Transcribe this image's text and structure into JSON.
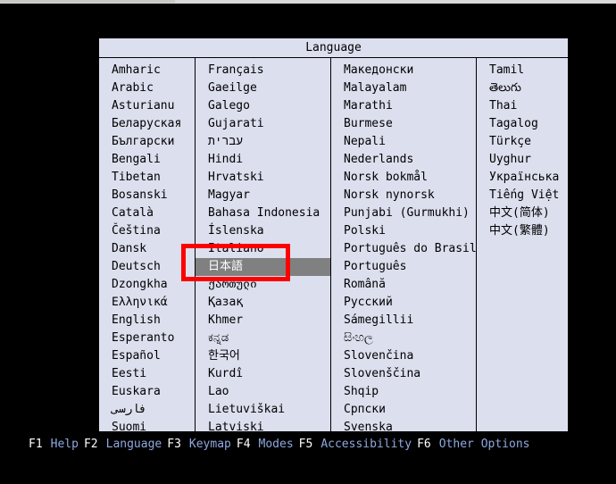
{
  "screen": {
    "background_color": "#000000"
  },
  "dialog": {
    "title": "Language",
    "title_bg": "#dcdfee",
    "body_bg": "#dcdfee",
    "border_color": "#000000",
    "selected_language": "日本語",
    "columns": [
      {
        "index": 0,
        "items": [
          "Amharic",
          "Arabic",
          "Asturianu",
          "Беларуская",
          "Български",
          "Bengali",
          "Tibetan",
          "Bosanski",
          "Català",
          "Čeština",
          "Dansk",
          "Deutsch",
          "Dzongkha",
          "Ελληνικά",
          "English",
          "Esperanto",
          "Español",
          "Eesti",
          "Euskara",
          "فارسی",
          "Suomi"
        ]
      },
      {
        "index": 1,
        "items": [
          "Français",
          "Gaeilge",
          "Galego",
          "Gujarati",
          "עברית",
          "Hindi",
          "Hrvatski",
          "Magyar",
          "Bahasa Indonesia",
          "Íslenska",
          "Italiano",
          "日本語",
          "ქართული",
          "Қазақ",
          "Khmer",
          "ಕನ್ನಡ",
          "한국어",
          "Kurdî",
          "Lao",
          "Lietuviškai",
          "Latviski"
        ]
      },
      {
        "index": 2,
        "items": [
          "Македонски",
          "Malayalam",
          "Marathi",
          "Burmese",
          "Nepali",
          "Nederlands",
          "Norsk bokmål",
          "Norsk nynorsk",
          "Punjabi (Gurmukhi)",
          "Polski",
          "Português do Brasil",
          "Português",
          "Română",
          "Русский",
          "Sámegillii",
          "සිංහල",
          "Slovenčina",
          "Slovenščina",
          "Shqip",
          "Српски",
          "Svenska"
        ]
      },
      {
        "index": 3,
        "items": [
          "Tamil",
          "తెలుగు",
          "Thai",
          "Tagalog",
          "Türkçe",
          "Uyghur",
          "Українська",
          "Tiếng Việt",
          "中文(简体)",
          "中文(繁體)"
        ]
      }
    ]
  },
  "annotation": {
    "color": "#ff0000",
    "target": "日本語"
  },
  "function_keys": [
    {
      "key": "F1",
      "label": "Help"
    },
    {
      "key": "F2",
      "label": "Language"
    },
    {
      "key": "F3",
      "label": "Keymap"
    },
    {
      "key": "F4",
      "label": "Modes"
    },
    {
      "key": "F5",
      "label": "Accessibility"
    },
    {
      "key": "F6",
      "label": "Other Options"
    }
  ],
  "colors": {
    "key_text": "#ffffff",
    "label_text": "#8fa8e0",
    "selection_bg": "#808080",
    "selection_text": "#ffffff"
  }
}
